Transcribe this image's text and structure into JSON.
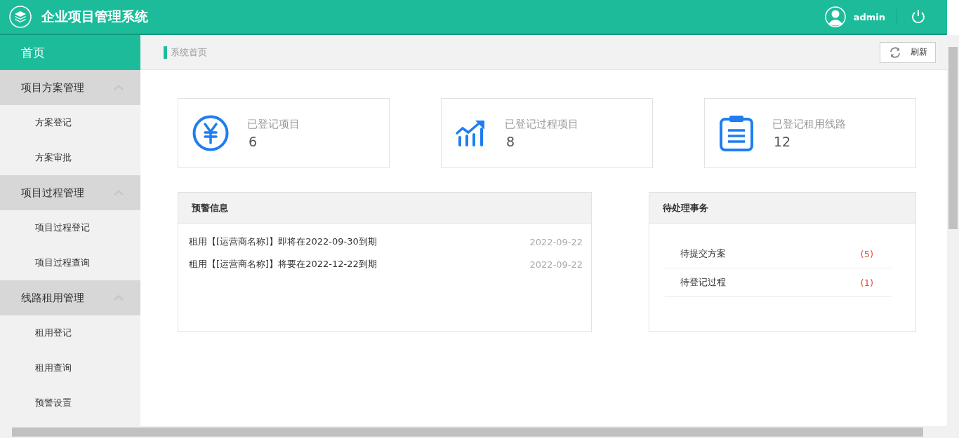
{
  "header": {
    "title": "企业项目管理系统",
    "user": "admin"
  },
  "sidebar": {
    "home": {
      "label": "首页",
      "selected": true
    },
    "groups": [
      {
        "label": "项目方案管理",
        "expanded": true,
        "items": [
          "方案登记",
          "方案审批"
        ]
      },
      {
        "label": "项目过程管理",
        "expanded": true,
        "items": [
          "项目过程登记",
          "项目过程查询"
        ]
      },
      {
        "label": "线路租用管理",
        "expanded": true,
        "items": [
          "租用登记",
          "租用查询",
          "预警设置"
        ]
      }
    ]
  },
  "breadcrumb": "系统首页",
  "refresh_button": "刷新",
  "stats": [
    {
      "kind": "yen",
      "label": "已登记项目",
      "value": "6"
    },
    {
      "kind": "chart",
      "label": "已登记过程项目",
      "value": "8"
    },
    {
      "kind": "clipboard",
      "label": "已登记租用线路",
      "value": "12"
    }
  ],
  "warnings": {
    "title": "预警信息",
    "rows": [
      {
        "text": "租用【[运营商名称]】即将在2022-09-30到期",
        "date": "2022-09-22"
      },
      {
        "text": "租用【[运营商名称]】将要在2022-12-22到期",
        "date": "2022-09-22"
      }
    ]
  },
  "pending": {
    "title": "待处理事务",
    "rows": [
      {
        "label": "待提交方案",
        "count": "(5)"
      },
      {
        "label": "待登记过程",
        "count": "(1)"
      }
    ]
  }
}
